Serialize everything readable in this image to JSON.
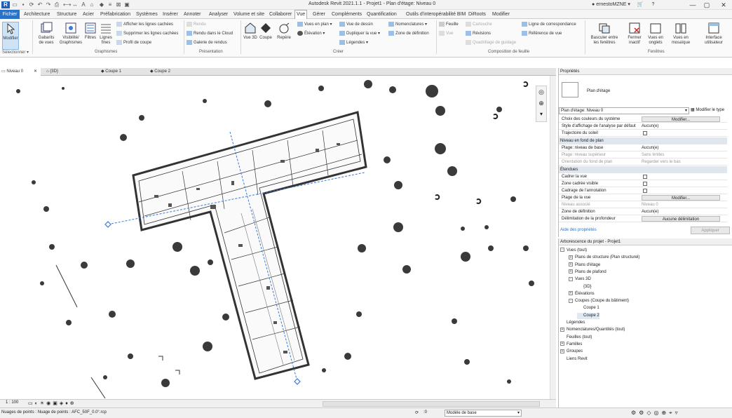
{
  "title_bar": {
    "app_title": "Autodesk Revit 2021.1.1 - Projet1 - Plan d'étage: Niveau 0",
    "user": "ernestoMZNE"
  },
  "menu_tabs": [
    "Fichier",
    "Architecture",
    "Structure",
    "Acier",
    "Préfabrication",
    "Systèmes",
    "Insérer",
    "Annoter",
    "Analyser",
    "Volume et site",
    "Collaborer",
    "Vue",
    "Gérer",
    "Compléments",
    "Quantification",
    "Outils d'interopérabilité BIM",
    "DiRoots",
    "Modifier"
  ],
  "ribbon": {
    "modify_label": "Modifier",
    "select_label": "Sélectionner",
    "graphics": {
      "gabarits": "Gabarits de vues",
      "visibilite": "Visibilité/ Graphismes",
      "filtres": "Filtres",
      "lignes_fines": "Lignes fines",
      "afficher_lignes": "Afficher les lignes cachées",
      "supprimer_lignes": "Supprimer les lignes cachées",
      "profil_coupe": "Profil de coupe",
      "panel": "Graphismes"
    },
    "presentation": {
      "rendu": "Rendu",
      "rendu_cloud": "Rendu dans le Cloud",
      "galerie": "Galerie de rendus",
      "panel": "Présentation"
    },
    "creer": {
      "vue3d": "Vue 3D",
      "coupe": "Coupe",
      "repere": "Repère",
      "vues_plan": "Vues en plan",
      "elevation": "Élévation",
      "vue_dessin": "Vue de dessin",
      "dupliquer": "Dupliquer la vue",
      "legendes": "Légendes",
      "nomenclatures": "Nomenclatures",
      "zone_def": "Zone de définition",
      "panel": "Créer"
    },
    "composition": {
      "feuille": "Feuille",
      "vue": "Vue",
      "cartouche": "Cartouche",
      "revisions": "Révisions",
      "quadrillage": "Quadrillage de guidage",
      "ligne_corresp": "Ligne de correspondance",
      "ref_vue": "Référence de vue",
      "panel": "Composition de feuille"
    },
    "fenetres": {
      "basculer": "Basculer entre les fenêtres",
      "fermer": "Fermer inactif",
      "onglets": "Vues en onglets",
      "mosaique": "Vues en mosaïque",
      "interface": "Interface utilisateur",
      "panel": "Fenêtres"
    }
  },
  "view_tabs": [
    "Niveau 0",
    "{3D}",
    "Coupe 1",
    "Coupe 2"
  ],
  "properties": {
    "header": "Propriétés",
    "type_name": "Plan d'étage",
    "type_selector": "Plan d'étage: Niveau 0",
    "edit_type": "Modifier le type",
    "rows_top": [
      {
        "k": "Choix des couleurs du système",
        "v": "Modifier...",
        "kind": "button"
      },
      {
        "k": "Style d'affichage de l'analyse par défaut",
        "v": "Aucun(e)",
        "kind": "text"
      },
      {
        "k": "Trajectoire du soleil",
        "v": "",
        "kind": "check"
      }
    ],
    "section_underlay": "Niveau en fond de plan",
    "rows_underlay": [
      {
        "k": "Plage: niveau de base",
        "v": "Aucun(e)",
        "kind": "text",
        "dim": false
      },
      {
        "k": "Plage: niveau supérieur",
        "v": "Sans limites",
        "kind": "text",
        "dim": true
      },
      {
        "k": "Orientation du fond de plan",
        "v": "Regarder vers le bas",
        "kind": "text",
        "dim": true
      }
    ],
    "section_extents": "Étendues",
    "rows_extents": [
      {
        "k": "Cadrer la vue",
        "v": "",
        "kind": "check",
        "dim": false
      },
      {
        "k": "Zone cadrée visible",
        "v": "",
        "kind": "check",
        "dim": false
      },
      {
        "k": "Cadrage de l'annotation",
        "v": "",
        "kind": "check",
        "dim": false
      },
      {
        "k": "Plage de la vue",
        "v": "Modifier...",
        "kind": "button",
        "dim": false
      },
      {
        "k": "Niveau associé",
        "v": "Niveau 0",
        "kind": "text",
        "dim": true
      },
      {
        "k": "Zone de définition",
        "v": "Aucun(e)",
        "kind": "text",
        "dim": false
      },
      {
        "k": "Délimitation de la profondeur",
        "v": "Aucune délimitation",
        "kind": "button",
        "dim": false
      }
    ],
    "help_link": "Aide des propriétés",
    "apply": "Appliquer"
  },
  "project_browser": {
    "header": "Arborescence du projet - Projet1",
    "nodes": [
      {
        "t": "Vues (tout)",
        "lvl": 0,
        "tg": "-"
      },
      {
        "t": "Plans de structure (Plan structurel)",
        "lvl": 1,
        "tg": "+"
      },
      {
        "t": "Plans d'étage",
        "lvl": 1,
        "tg": "+"
      },
      {
        "t": "Plans de plafond",
        "lvl": 1,
        "tg": "+"
      },
      {
        "t": "Vues 3D",
        "lvl": 1,
        "tg": "-"
      },
      {
        "t": "{3D}",
        "lvl": 2,
        "tg": ""
      },
      {
        "t": "Élévations",
        "lvl": 1,
        "tg": "+"
      },
      {
        "t": "Coupes (Coupe du bâtiment)",
        "lvl": 1,
        "tg": "-"
      },
      {
        "t": "Coupe 1",
        "lvl": 2,
        "tg": ""
      },
      {
        "t": "Coupe 2",
        "lvl": 2,
        "tg": ""
      },
      {
        "t": "Légendes",
        "lvl": 0,
        "tg": ""
      },
      {
        "t": "Nomenclatures/Quantités (tout)",
        "lvl": 0,
        "tg": "+"
      },
      {
        "t": "Feuilles (tout)",
        "lvl": 0,
        "tg": ""
      },
      {
        "t": "Familles",
        "lvl": 0,
        "tg": "+"
      },
      {
        "t": "Groupes",
        "lvl": 0,
        "tg": "+"
      },
      {
        "t": "Liens Revit",
        "lvl": 0,
        "tg": ""
      }
    ]
  },
  "view_control": {
    "scale": "1 : 100"
  },
  "status": {
    "message": "Nuages de points : Nuage de points : AFC_50F_0.0°.rcp",
    "model": "Modèle de base",
    "coord": ":0"
  },
  "colors": {
    "accent": "#2a72c7",
    "section_line": "#3a7ad8",
    "plan_ink": "#333333"
  }
}
